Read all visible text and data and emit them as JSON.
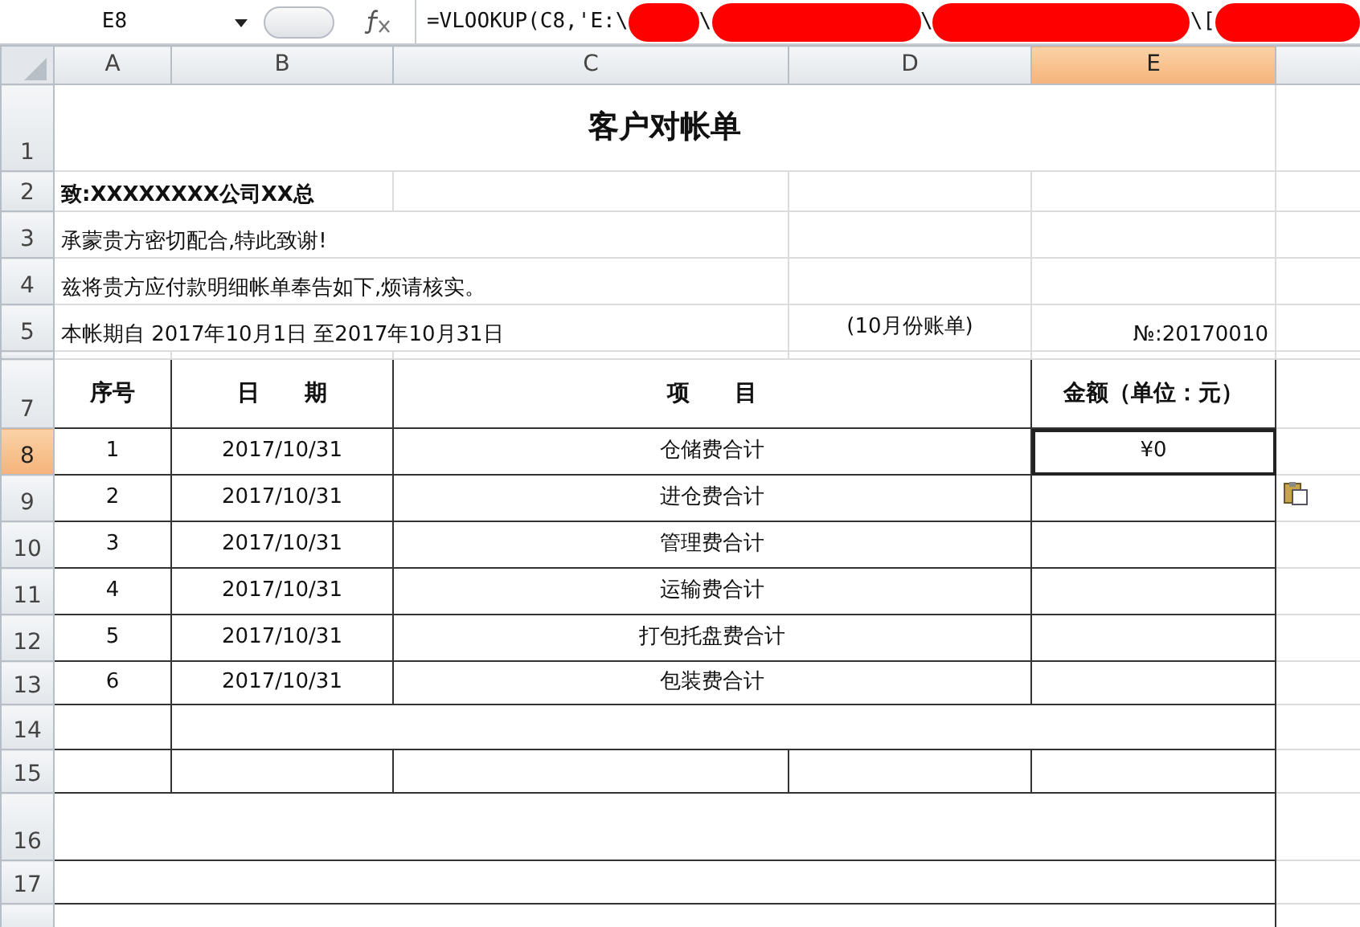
{
  "formula_bar": {
    "name_box": "E8",
    "formula": [
      {
        "kind": "text",
        "text": "=VLOOKUP(C8,'E:\\"
      },
      {
        "kind": "redacted"
      },
      {
        "kind": "text",
        "text": "\\"
      },
      {
        "kind": "redacted"
      },
      {
        "kind": "text",
        "text": "\\"
      },
      {
        "kind": "redacted"
      },
      {
        "kind": "text",
        "text": "\\["
      },
      {
        "kind": "redacted"
      }
    ]
  },
  "column_headers": [
    {
      "label": "A",
      "selected": false
    },
    {
      "label": "B",
      "selected": false
    },
    {
      "label": "C",
      "selected": false
    },
    {
      "label": "D",
      "selected": false
    },
    {
      "label": "E",
      "selected": true
    }
  ],
  "row_headers": [
    {
      "label": "1",
      "selected": false
    },
    {
      "label": "2",
      "selected": false
    },
    {
      "label": "3",
      "selected": false
    },
    {
      "label": "4",
      "selected": false
    },
    {
      "label": "5",
      "selected": false
    },
    {
      "label": "7",
      "selected": false
    },
    {
      "label": "8",
      "selected": true
    },
    {
      "label": "9",
      "selected": false
    },
    {
      "label": "10",
      "selected": false
    },
    {
      "label": "11",
      "selected": false
    },
    {
      "label": "12",
      "selected": false
    },
    {
      "label": "13",
      "selected": false
    },
    {
      "label": "14",
      "selected": false
    },
    {
      "label": "15",
      "selected": false
    },
    {
      "label": "16",
      "selected": false
    },
    {
      "label": "17",
      "selected": false
    }
  ],
  "sheet": {
    "title": "客户对帐单",
    "recipient": "致:XXXXXXXX公司XX总",
    "lines": [
      "承蒙贵方密切配合,特此致谢!",
      "兹将贵方应付款明细帐单奉告如下,烦请核实。"
    ],
    "period": "本帐期自  2017年10月1日 至2017年10月31日",
    "month_note": "(10月份账单)",
    "number": "№:20170010",
    "table": {
      "columns": [
        "序号",
        "日　　期",
        "项　　目",
        "金额（单位：元）"
      ],
      "rows": [
        {
          "no": "1",
          "date": "2017/10/31",
          "item": "仓储费合计",
          "amount": "¥0",
          "selected": true
        },
        {
          "no": "2",
          "date": "2017/10/31",
          "item": "进仓费合计",
          "selected": false
        },
        {
          "no": "3",
          "date": "2017/10/31",
          "item": "管理费合计",
          "selected": false
        },
        {
          "no": "4",
          "date": "2017/10/31",
          "item": "运输费合计",
          "selected": false
        },
        {
          "no": "5",
          "date": "2017/10/31",
          "item": "打包托盘费合计",
          "selected": false
        },
        {
          "no": "6",
          "date": "2017/10/31",
          "item": "包装费合计",
          "selected": false
        }
      ]
    }
  }
}
